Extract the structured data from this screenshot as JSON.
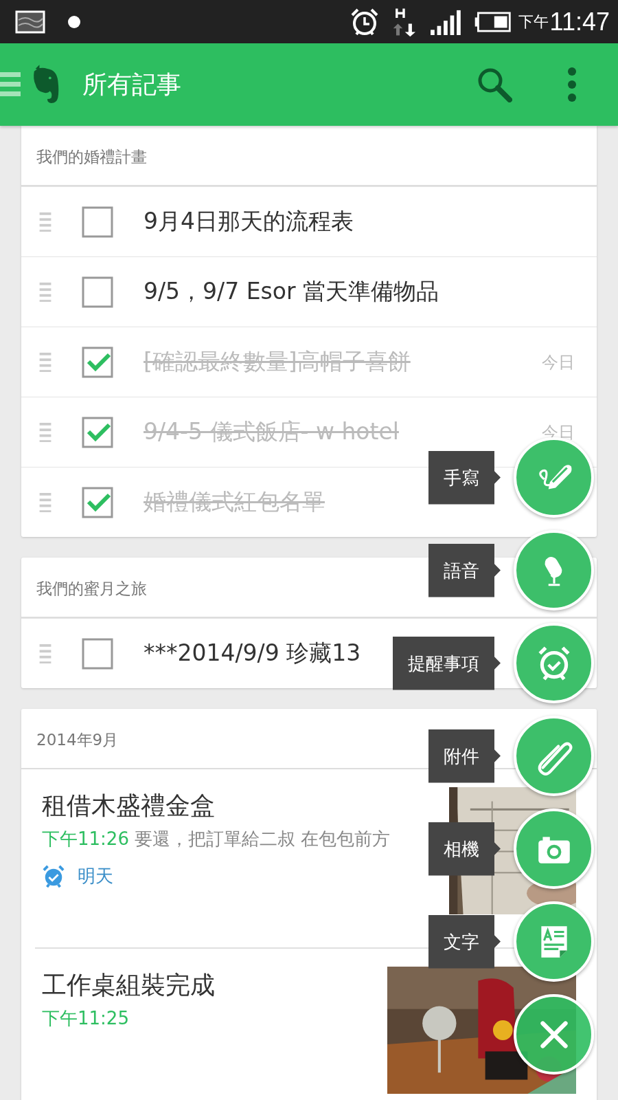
{
  "status_bar": {
    "period": "下午",
    "time": "11:47"
  },
  "app_bar": {
    "title": "所有記事"
  },
  "checklists": [
    {
      "heading": "我們的婚禮計畫",
      "items": [
        {
          "text": "9月4日那天的流程表",
          "checked": false
        },
        {
          "text": "9/5，9/7 Esor 當天準備物品",
          "checked": false
        },
        {
          "text": "[確認最終數量]高帽子喜餅",
          "checked": true,
          "date": "今日"
        },
        {
          "text": "9/4-5 儀式飯店- w hotel",
          "checked": true,
          "date": "今日"
        },
        {
          "text": "婚禮儀式紅包名單",
          "checked": true
        }
      ]
    },
    {
      "heading": "我們的蜜月之旅",
      "items": [
        {
          "text": "***2014/9/9 珍藏13",
          "checked": false
        }
      ]
    }
  ],
  "notes": {
    "heading": "2014年9月",
    "items": [
      {
        "title": "租借木盛禮金盒",
        "time": "下午11:26",
        "snippet": "要還，把訂單給二叔 在包包前方",
        "reminder": "明天"
      },
      {
        "title": "工作桌組裝完成",
        "time": "下午11:25"
      }
    ]
  },
  "fab_menu": {
    "actions": [
      {
        "label": "手寫",
        "kind": "handwriting"
      },
      {
        "label": "語音",
        "kind": "audio"
      },
      {
        "label": "提醒事項",
        "kind": "reminder"
      },
      {
        "label": "附件",
        "kind": "attachment"
      },
      {
        "label": "相機",
        "kind": "camera"
      },
      {
        "label": "文字",
        "kind": "text"
      }
    ],
    "close": {
      "kind": "close"
    }
  }
}
